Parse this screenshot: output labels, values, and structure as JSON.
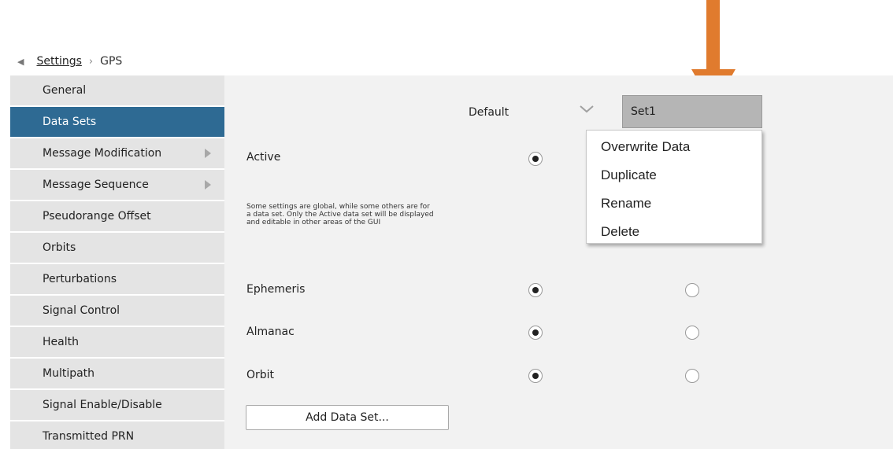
{
  "breadcrumb": {
    "parent": "Settings",
    "separator": "›",
    "current": "GPS"
  },
  "sidebar": {
    "items": [
      {
        "label": "General"
      },
      {
        "label": "Data Sets"
      },
      {
        "label": "Message Modification"
      },
      {
        "label": "Message Sequence"
      },
      {
        "label": "Pseudorange Offset"
      },
      {
        "label": "Orbits"
      },
      {
        "label": "Perturbations"
      },
      {
        "label": "Signal Control"
      },
      {
        "label": "Health"
      },
      {
        "label": "Multipath"
      },
      {
        "label": "Signal Enable/Disable"
      },
      {
        "label": "Transmitted PRN"
      }
    ],
    "active": "Data Sets",
    "with_submenu": [
      "Message Modification",
      "Message Sequence"
    ]
  },
  "main": {
    "column_default": "Default",
    "selected_set": "Set1",
    "help_text": "Some settings are global, while some others are for a data set. Only the Active data set will be displayed and editable in other areas of the GUI",
    "rows": [
      {
        "label": "Active",
        "default_selected": true,
        "set1_selected": null
      },
      {
        "label": "Ephemeris",
        "default_selected": true,
        "set1_selected": false
      },
      {
        "label": "Almanac",
        "default_selected": true,
        "set1_selected": false
      },
      {
        "label": "Orbit",
        "default_selected": true,
        "set1_selected": false
      }
    ],
    "add_button": "Add Data Set..."
  },
  "context_menu": {
    "items": [
      "Overwrite Data",
      "Duplicate",
      "Rename",
      "Delete"
    ]
  },
  "colors": {
    "accent": "#2e6a93",
    "arrow": "#e07b2e",
    "sidebar_bg": "#e4e4e4",
    "panel_bg": "#f2f2f2"
  }
}
